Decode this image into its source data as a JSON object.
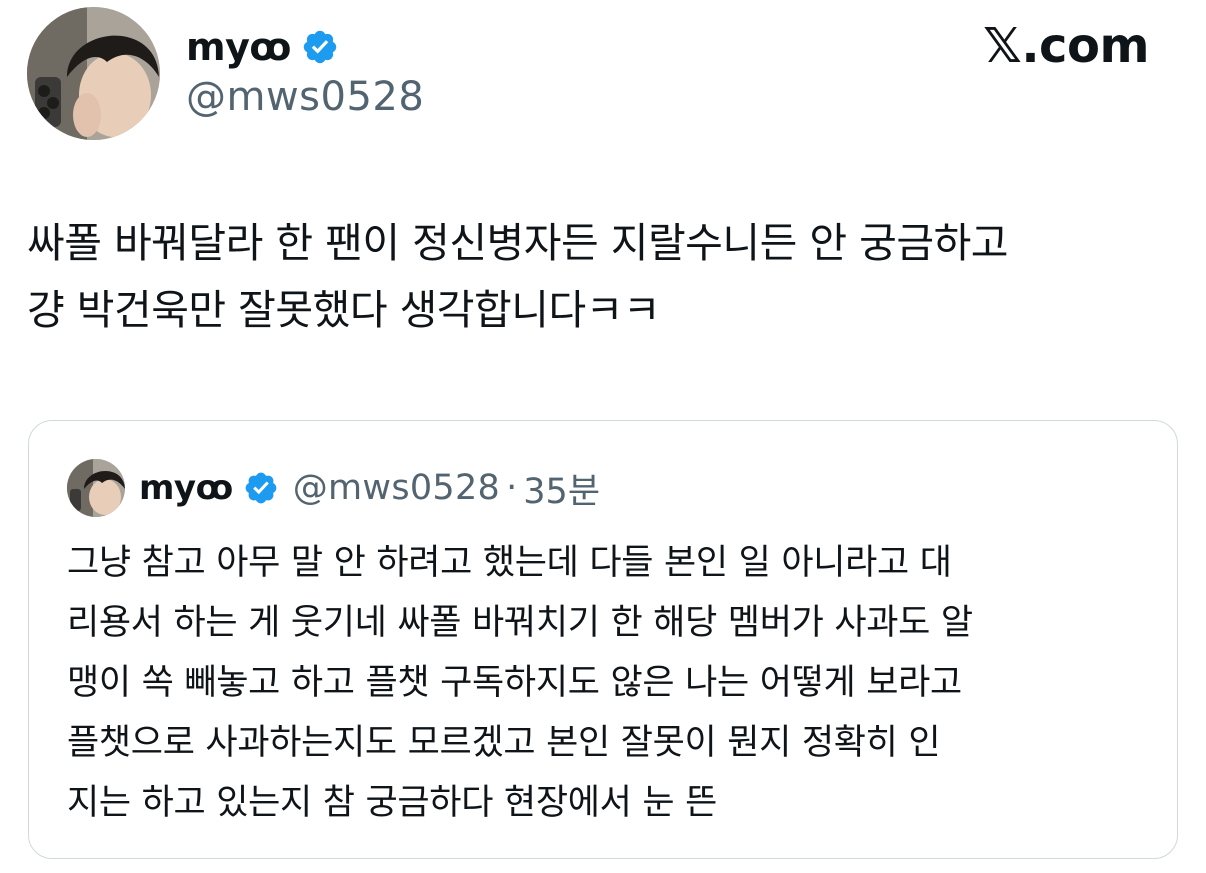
{
  "author": {
    "display_name": "myꝏ",
    "handle": "@mws0528",
    "verified": true,
    "avatar": "profile-photo"
  },
  "brand": {
    "label": "𝕏.com"
  },
  "tweet": {
    "text": "싸폴 바꿔달라 한 팬이 정신병자든 지랄수니든 안 궁금하고\n걍 박건욱만 잘못했다 생각합니다ㅋㅋ"
  },
  "quoted_tweet": {
    "display_name": "myꝏ",
    "handle": "@mws0528",
    "separator": "·",
    "time": "35분",
    "verified": true,
    "text": "그냥 참고 아무 말 안 하려고 했는데 다들 본인 일 아니라고 대\n리용서 하는 게 웃기네 싸폴 바꿔치기 한 해당 멤버가 사과도 알\n맹이 쏙 빼놓고 하고 플챗 구독하지도 않은 나는 어떻게 보라고\n플챗으로 사과하는지도 모르겠고 본인 잘못이 뭔지 정확히 인\n지는 하고 있는지 참 궁금하다 현장에서 눈 뜬"
  },
  "colors": {
    "text_primary": "#0f1419",
    "text_secondary": "#536471",
    "verified_blue": "#1d9bf0",
    "border": "#cfd9de"
  }
}
